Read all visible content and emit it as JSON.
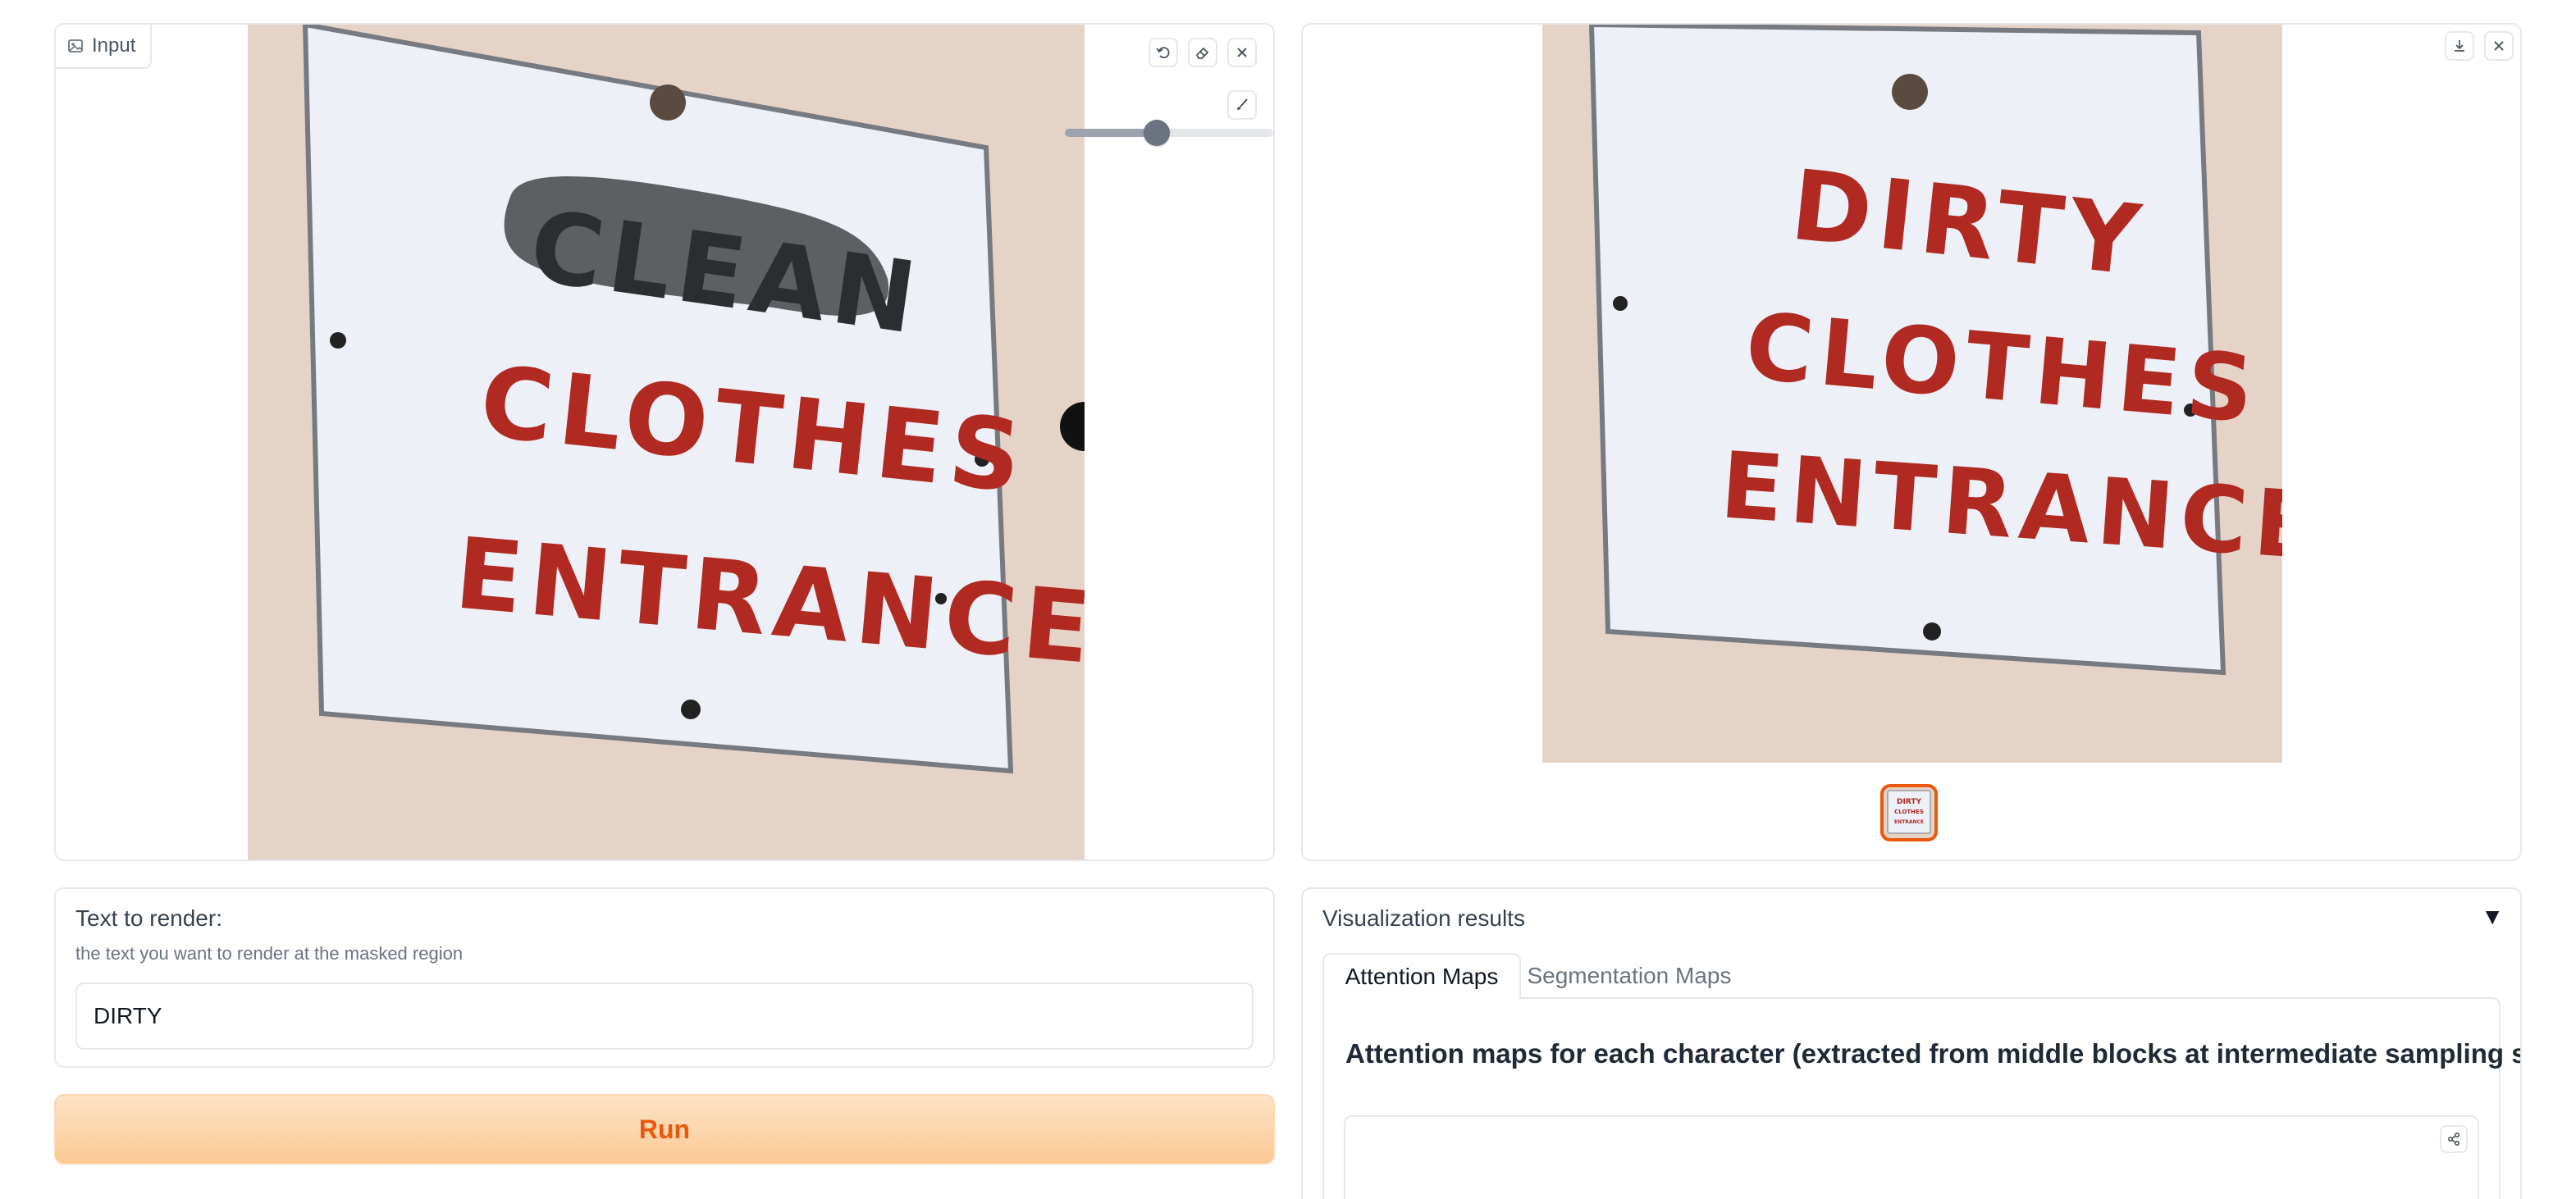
{
  "input_panel": {
    "label": "Input",
    "sign_lines": [
      "CLEAN",
      "CLOTHES",
      "ENTRANCE"
    ],
    "brush_size_fraction": 0.44,
    "icons": [
      "image-icon",
      "undo-icon",
      "eraser-icon",
      "close-icon",
      "brush-icon"
    ]
  },
  "output_panel": {
    "sign_lines": [
      "DIRTY",
      "CLOTHES",
      "ENTRANCE"
    ],
    "thumbnail_lines": [
      "DIRTY",
      "CLOTHES",
      "ENTRANCE"
    ],
    "icons": [
      "download-icon",
      "close-icon"
    ]
  },
  "text_field": {
    "label": "Text to render:",
    "info": "the text you want to render at the masked region",
    "value": "DIRTY"
  },
  "run_button": {
    "label": "Run"
  },
  "visualization": {
    "title": "Visualization results",
    "caret": "▼",
    "tabs": [
      {
        "label": "Attention Maps",
        "active": true
      },
      {
        "label": "Segmentation Maps",
        "active": false
      }
    ],
    "heading": "Attention maps for each character (extracted from middle blocks at intermediate sampling step):"
  },
  "colors": {
    "accent": "#ea580c",
    "text_red": "#b02a22",
    "wall": "#e6d3c8",
    "sign": "#eef0f7",
    "mask": "#55565a"
  }
}
